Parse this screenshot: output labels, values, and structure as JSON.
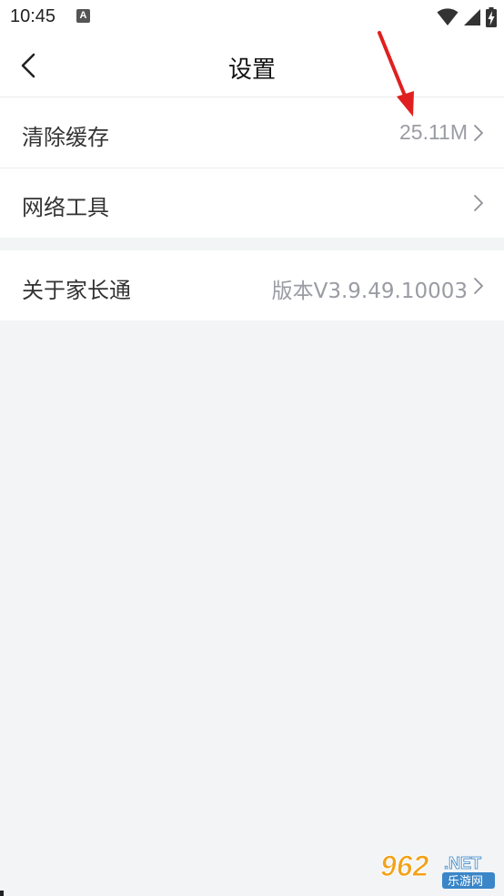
{
  "status_bar": {
    "time": "10:45",
    "notification_badge": "A",
    "icons": [
      "wifi-icon",
      "signal-icon",
      "battery-charging-icon"
    ]
  },
  "nav": {
    "title": "设置",
    "back_icon": "chevron-left-icon"
  },
  "settings": {
    "group1": [
      {
        "label": "清除缓存",
        "value": "25.11M",
        "icon": "chevron-right-icon"
      },
      {
        "label": "网络工具",
        "value": "",
        "icon": "chevron-right-icon"
      }
    ],
    "group2": [
      {
        "label": "关于家长通",
        "value": "版本V3.9.49.10003",
        "icon": "chevron-right-icon"
      }
    ]
  },
  "annotation": {
    "arrow_color": "#e02020"
  },
  "watermark": {
    "text_large": "962",
    "text_net": ".NET",
    "text_cn": "乐游网"
  },
  "colors": {
    "background": "#f3f4f6",
    "surface": "#ffffff",
    "secondary_text": "#9a9ca3"
  }
}
